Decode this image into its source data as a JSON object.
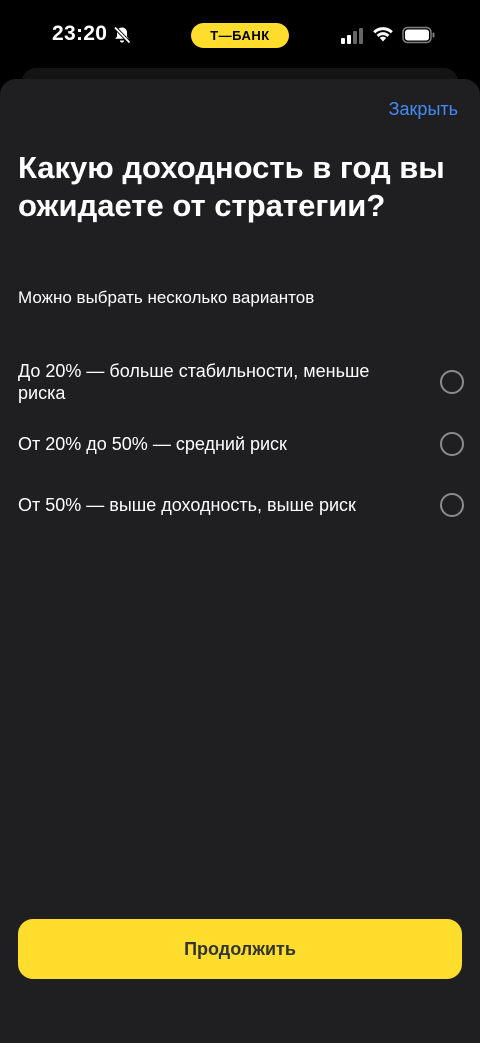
{
  "status_bar": {
    "time": "23:20",
    "carrier": "Т—БАНК",
    "icons": [
      "bell-muted-icon",
      "signal-icon",
      "wifi-icon",
      "battery-icon"
    ]
  },
  "sheet": {
    "close_label": "Закрыть",
    "title": "Какую доходность в год вы ожидаете от стратегии?",
    "subtitle": "Можно выбрать несколько вариантов",
    "options": [
      {
        "label": "До 20% — больше стабильности, меньше риска",
        "selected": false
      },
      {
        "label": "От 20% до 50% — средний риск",
        "selected": false
      },
      {
        "label": "От 50% — выше доходность, выше риск",
        "selected": false
      }
    ],
    "continue_label": "Продолжить"
  },
  "colors": {
    "accent": "#FFDD2D",
    "link": "#428BF9",
    "sheet_background": "#1F1F21"
  }
}
